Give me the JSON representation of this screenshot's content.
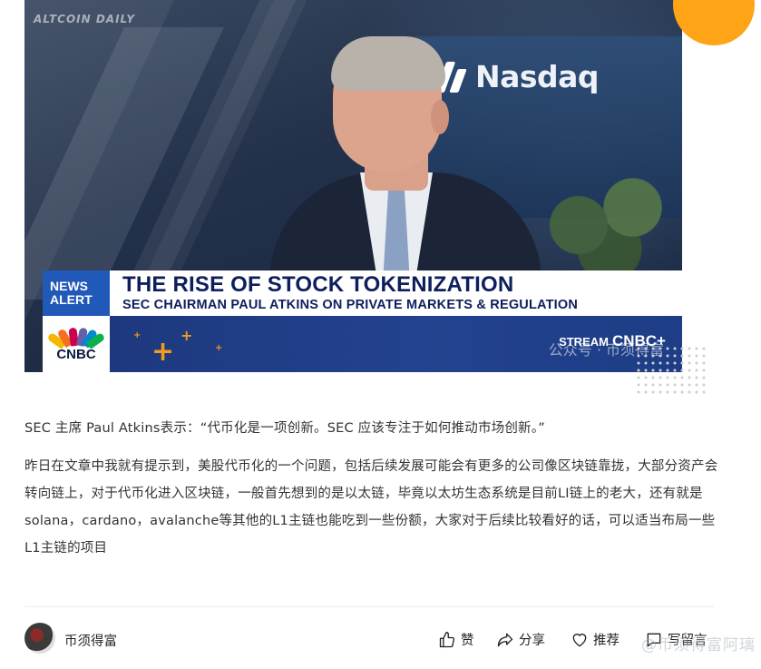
{
  "hero": {
    "watermark_top": "ALTCOIN DAILY",
    "nasdaq_label": "Nasdaq",
    "news_alert_line1": "NEWS",
    "news_alert_line2": "ALERT",
    "headline": "THE RISE OF STOCK TOKENIZATION",
    "subheadline": "SEC CHAIRMAN PAUL ATKINS ON PRIVATE MARKETS & REGULATION",
    "channel_logo": "CNBC",
    "stream_label": "STREAM",
    "stream_brand": "CNBC+",
    "wechat_watermark": "公众号 · 币须得富"
  },
  "article": {
    "quote": "SEC 主席 Paul Atkins表示：“代币化是一项创新。SEC 应该专注于如何推动市场创新。”",
    "paragraph": "昨日在文章中我就有提示到，美股代币化的一个问题，包括后续发展可能会有更多的公司像区块链靠拢，大部分资产会转向链上，对于代币化进入区块链，一般首先想到的是以太链，毕竟以太坊生态系统是目前LI链上的老大，还有就是solana，cardano，avalanche等其他的L1主链也能吃到一些份额，大家对于后续比较看好的话，可以适当布局一些L1主链的项目"
  },
  "footer": {
    "author": "币须得富",
    "like_label": "赞",
    "share_label": "分享",
    "recommend_label": "推荐",
    "comment_label": "写留言",
    "bottom_watermark": "@币须得富阿璃"
  },
  "colors": {
    "news_blue": "#2159b8",
    "headline_navy": "#0d1f5c",
    "accent_orange": "#ffa317"
  }
}
